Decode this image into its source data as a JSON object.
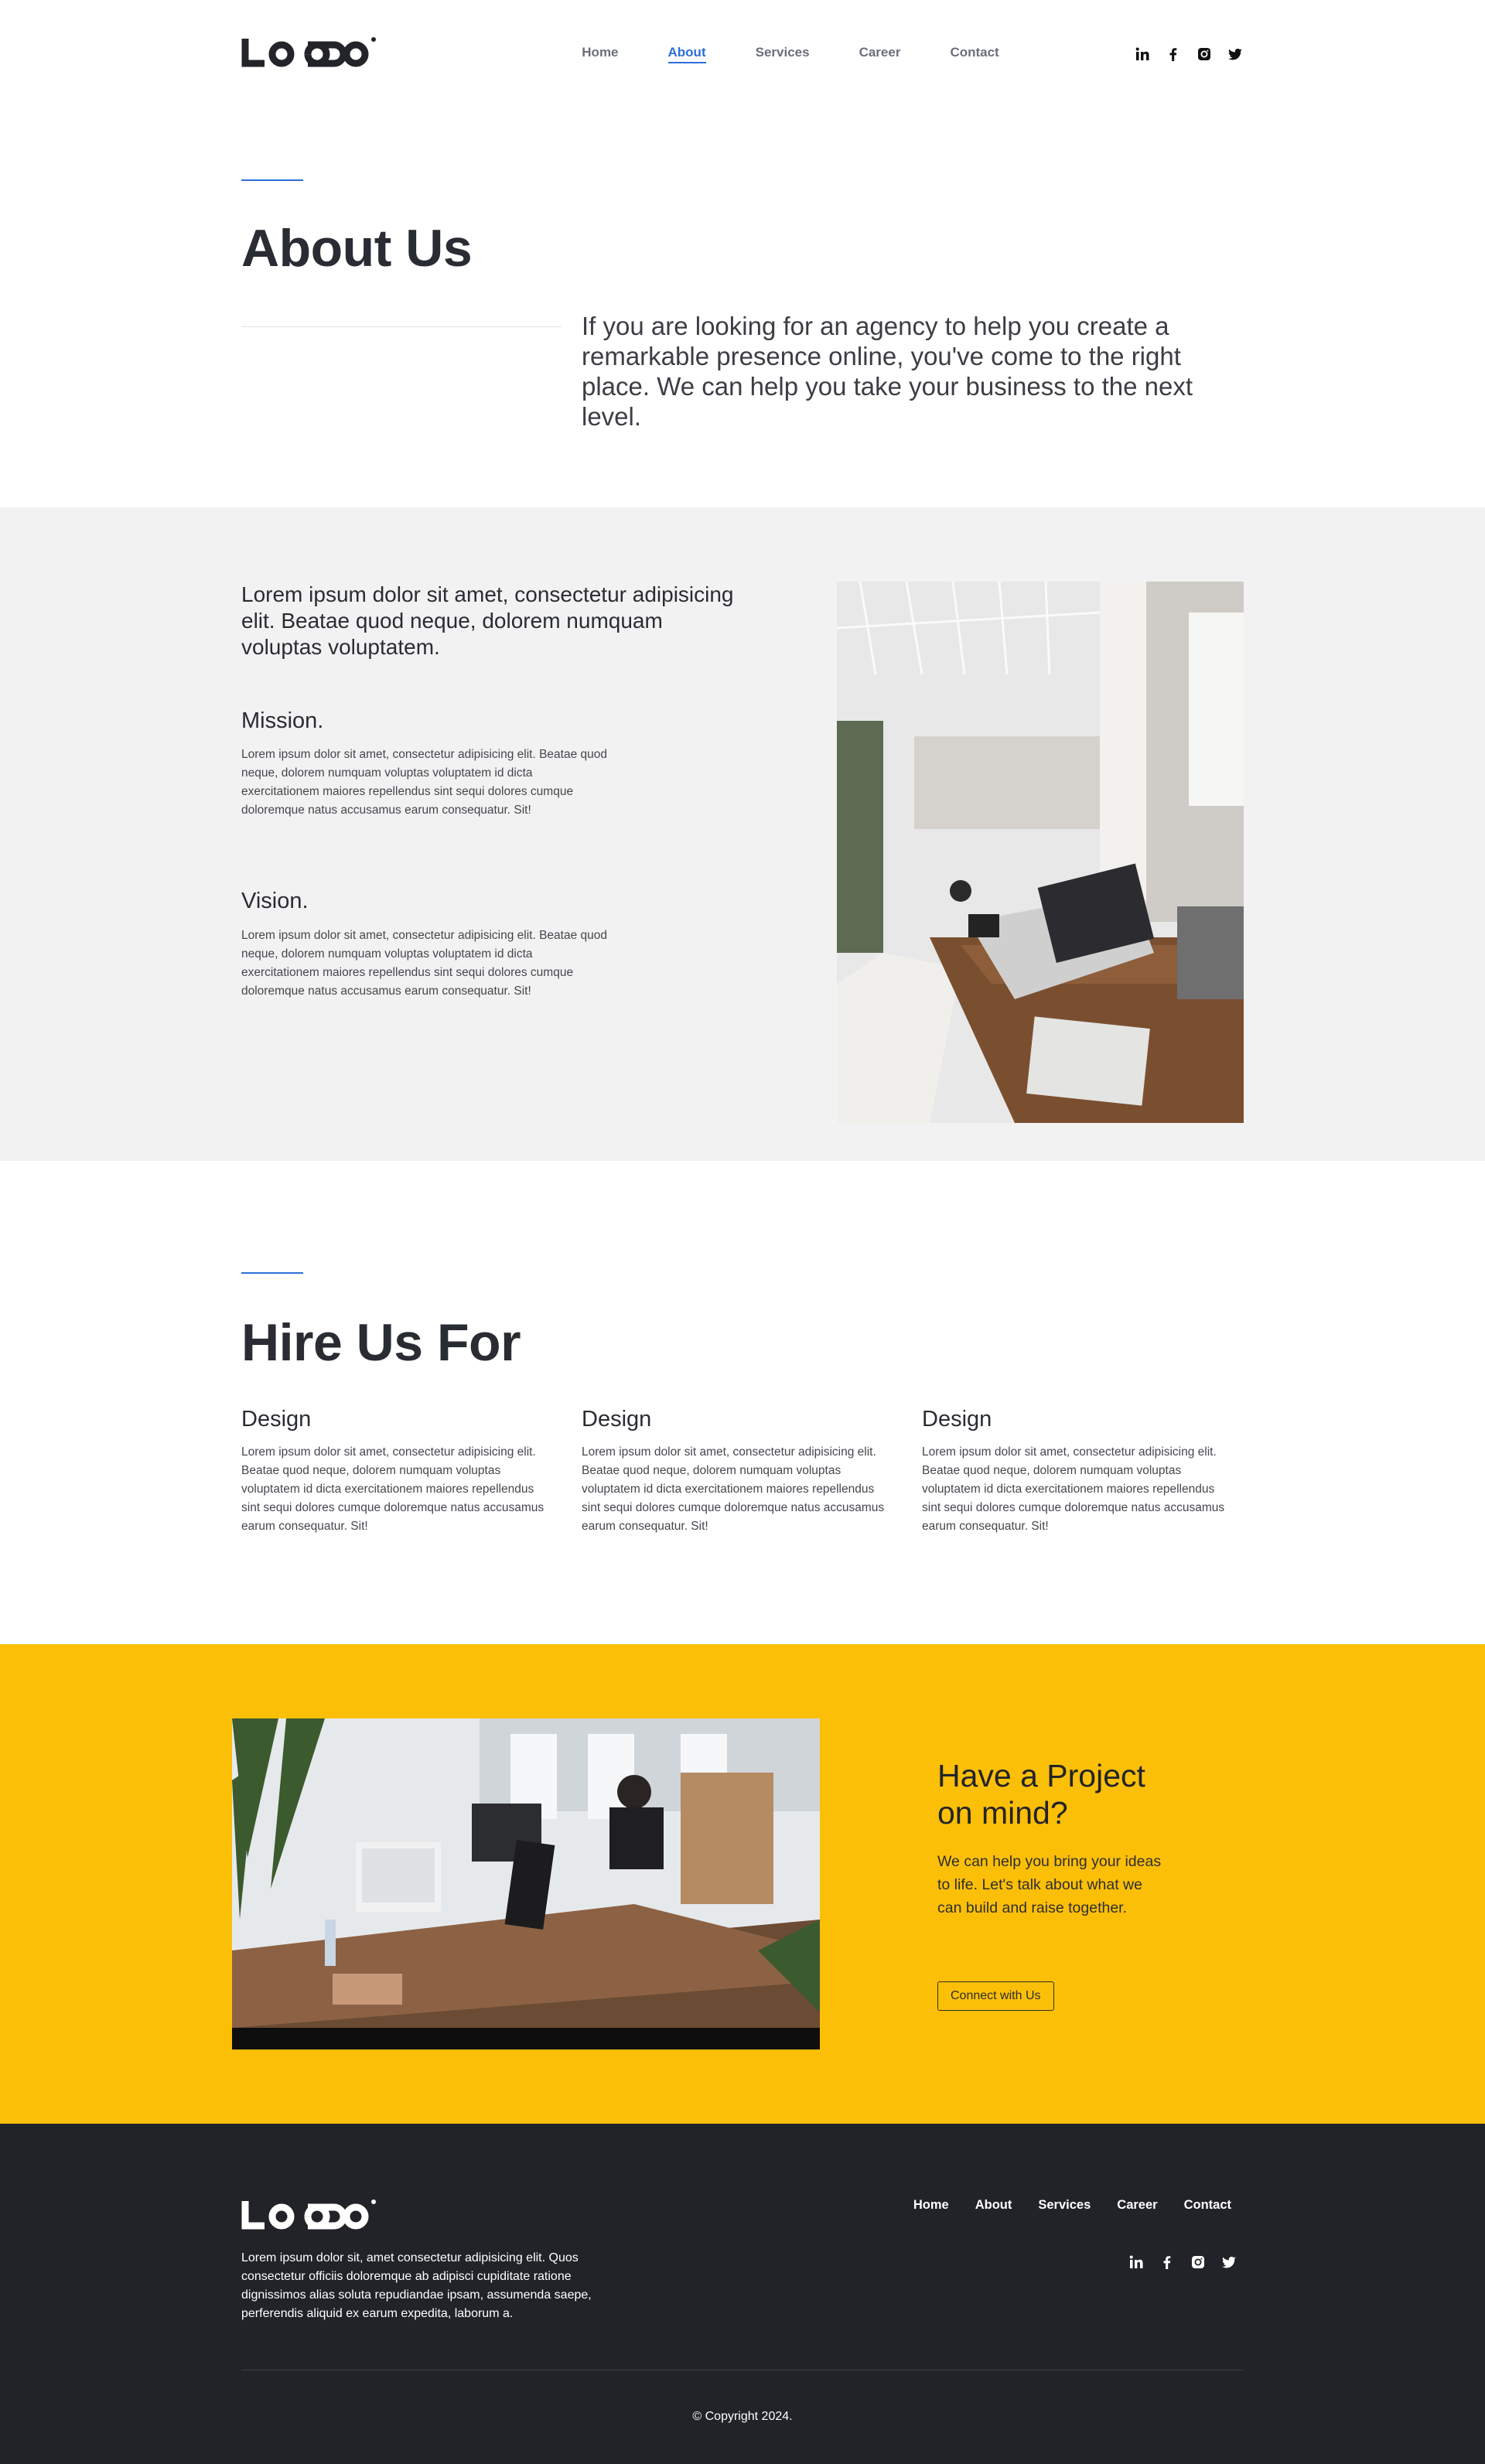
{
  "header": {
    "nav": [
      {
        "label": "Home"
      },
      {
        "label": "About"
      },
      {
        "label": "Services"
      },
      {
        "label": "Career"
      },
      {
        "label": "Contact"
      }
    ],
    "active_nav": "About",
    "social": [
      "linkedin-icon",
      "facebook-icon",
      "instagram-icon",
      "twitter-icon"
    ]
  },
  "about": {
    "title": "About Us",
    "lead": "If you are looking for an agency to help you create a remarkable presence online, you've come to the right place. We can help you take your business to the next level."
  },
  "intro": {
    "heading": "Lorem ipsum dolor sit amet, consectetur adipisicing elit. Beatae quod neque, dolorem numquam voluptas voluptatem.",
    "mission_title": "Mission.",
    "mission_text": "Lorem ipsum dolor sit amet, consectetur adipisicing elit. Beatae quod neque, dolorem numquam voluptas voluptatem id dicta exercitationem maiores repellendus sint sequi dolores cumque doloremque natus accusamus earum consequatur. Sit!",
    "vision_title": "Vision.",
    "vision_text": "Lorem ipsum dolor sit amet, consectetur adipisicing elit. Beatae quod neque, dolorem numquam voluptas voluptatem id dicta exercitationem maiores repellendus sint sequi dolores cumque doloremque natus accusamus earum consequatur. Sit!"
  },
  "hire": {
    "title": "Hire Us For",
    "items": [
      {
        "title": "Design",
        "text": "Lorem ipsum dolor sit amet, consectetur adipisicing elit. Beatae quod neque, dolorem numquam voluptas voluptatem id dicta exercitationem maiores repellendus sint sequi dolores cumque doloremque natus accusamus earum consequatur. Sit!"
      },
      {
        "title": "Design",
        "text": "Lorem ipsum dolor sit amet, consectetur adipisicing elit. Beatae quod neque, dolorem numquam voluptas voluptatem id dicta exercitationem maiores repellendus sint sequi dolores cumque doloremque natus accusamus earum consequatur. Sit!"
      },
      {
        "title": "Design",
        "text": "Lorem ipsum dolor sit amet, consectetur adipisicing elit. Beatae quod neque, dolorem numquam voluptas voluptatem id dicta exercitationem maiores repellendus sint sequi dolores cumque doloremque natus accusamus earum consequatur. Sit!"
      }
    ]
  },
  "cta": {
    "title": "Have a Project on mind?",
    "text": "We can help you bring your ideas to life. Let's talk about what we can build and raise together.",
    "button": "Connect with Us"
  },
  "footer": {
    "description": "Lorem ipsum dolor sit, amet consectetur adipisicing elit. Quos consectetur officiis doloremque ab adipisci cupiditate ratione dignissimos alias soluta repudiandae ipsam, assumenda saepe, perferendis aliquid ex earum expedita, laborum a.",
    "nav": [
      {
        "label": "Home"
      },
      {
        "label": "About"
      },
      {
        "label": "Services"
      },
      {
        "label": "Career"
      },
      {
        "label": "Contact"
      }
    ],
    "copyright": "© Copyright 2024."
  },
  "colors": {
    "accent": "#2c6fd8",
    "cta_bg": "#fcbf08",
    "footer_bg": "#212328",
    "section_gray": "#f2f2f2"
  }
}
